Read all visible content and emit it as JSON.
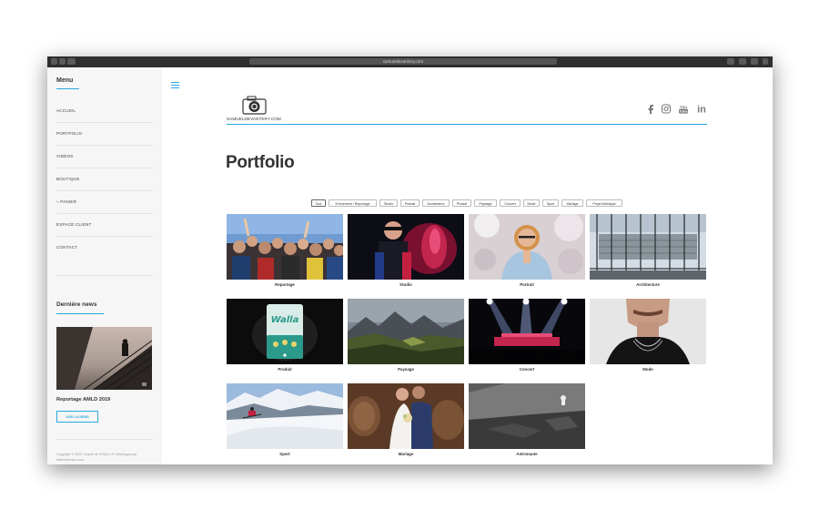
{
  "browser": {
    "url": "samueldevantery.com"
  },
  "sidebar": {
    "menu_title": "Menu",
    "items": [
      {
        "label": "ACCUEIL"
      },
      {
        "label": "PORTFOLIO"
      },
      {
        "label": "VIDÉOS"
      },
      {
        "label": "BOUTIQUE"
      },
      {
        "label": "PANIER"
      },
      {
        "label": "ESPACE CLIENT"
      },
      {
        "label": "CONTACT"
      }
    ],
    "news_title": "Dernière news",
    "news_caption": "Reportage AMLD 2019",
    "news_button": "VOIR LA NEWS",
    "copyright": "Copyright © 2020. Inspiré de VISALI LP. Développé par batherbernard.com"
  },
  "header": {
    "logo_text": "SAMUELDEVANTERY.COM",
    "social": [
      "facebook-icon",
      "instagram-icon",
      "youtube-icon",
      "linkedin-icon"
    ],
    "youtube_glyph": "You\nTube",
    "linkedin_glyph": "in"
  },
  "page": {
    "title": "Portfolio"
  },
  "filters": [
    {
      "label": "Tout",
      "active": true
    },
    {
      "label": "Evénement / Reportage"
    },
    {
      "label": "Studio"
    },
    {
      "label": "Portrait"
    },
    {
      "label": "Architecture"
    },
    {
      "label": "Produit"
    },
    {
      "label": "Paysage"
    },
    {
      "label": "Concert"
    },
    {
      "label": "Mode"
    },
    {
      "label": "Sport"
    },
    {
      "label": "Mariage"
    },
    {
      "label": "Projet Artistique"
    }
  ],
  "gallery": [
    {
      "label": "Reportage"
    },
    {
      "label": "Studio"
    },
    {
      "label": "Portrait"
    },
    {
      "label": "Architecture"
    },
    {
      "label": "Produit"
    },
    {
      "label": "Paysage"
    },
    {
      "label": "Concert"
    },
    {
      "label": "Mode"
    },
    {
      "label": "Sport"
    },
    {
      "label": "Mariage"
    },
    {
      "label": "Astronaute"
    }
  ],
  "product_artwork_text": "Walla",
  "colors": {
    "accent": "#29a9e0",
    "text": "#333333"
  }
}
